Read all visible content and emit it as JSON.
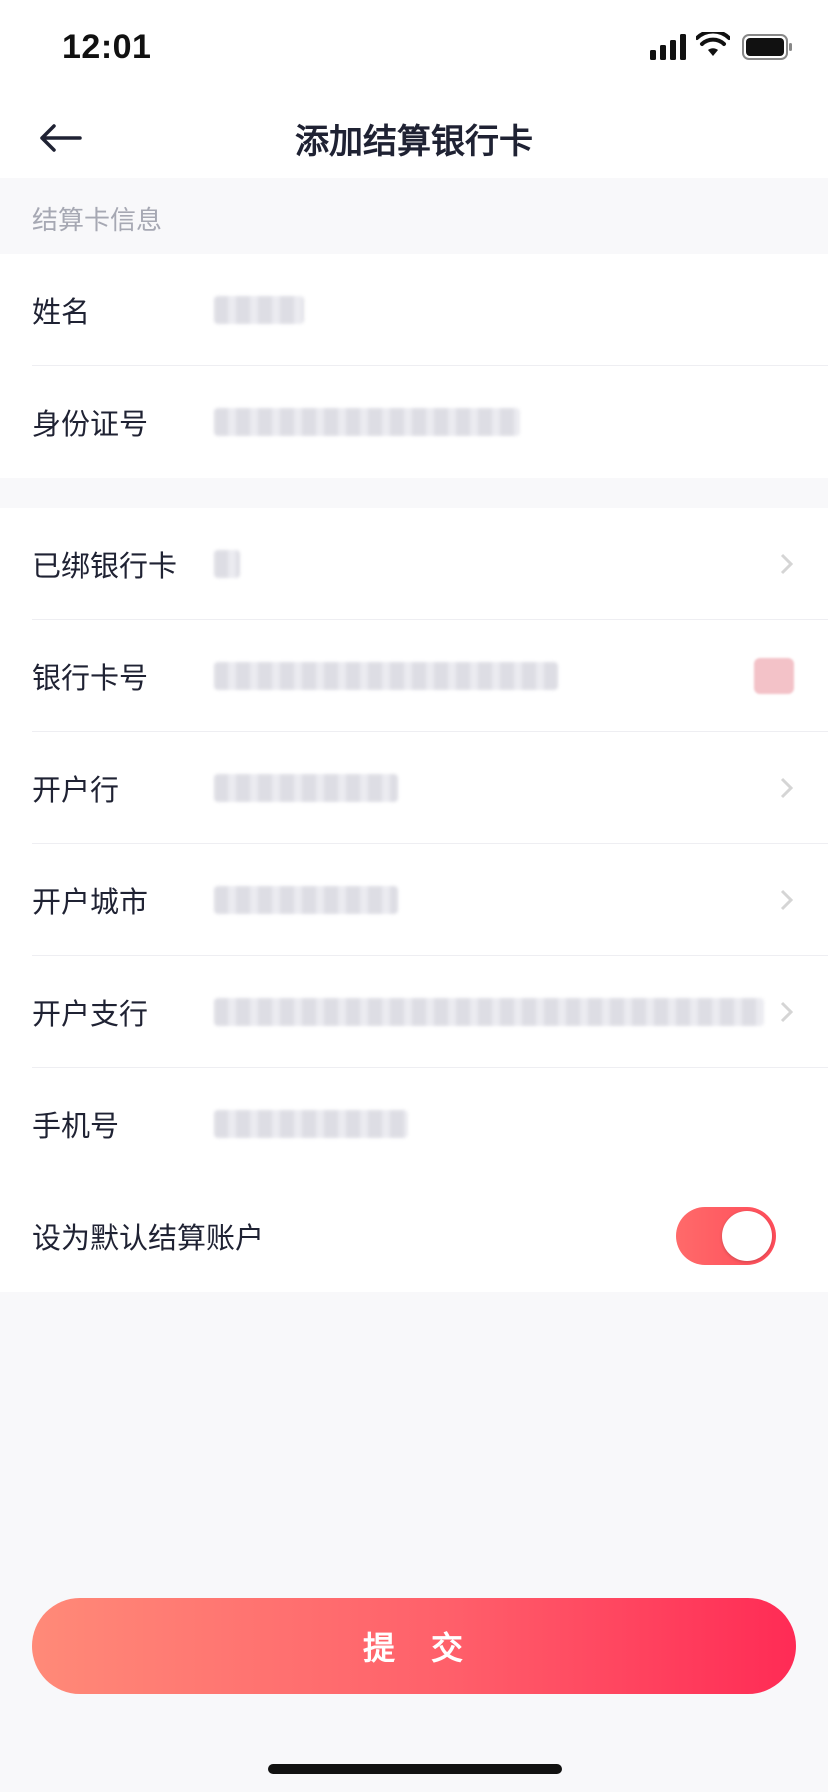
{
  "status_bar": {
    "time": "12:01",
    "icons": [
      "signal-icon",
      "wifi-icon",
      "battery-icon"
    ]
  },
  "nav": {
    "title": "添加结算银行卡",
    "back_icon": "back-arrow-icon"
  },
  "section": {
    "header": "结算卡信息"
  },
  "group1": [
    {
      "label": "姓名"
    },
    {
      "label": "身份证号"
    }
  ],
  "group2": [
    {
      "label": "已绑银行卡",
      "trailing": "chevron-right-icon"
    },
    {
      "label": "银行卡号",
      "trailing": "camera-icon"
    },
    {
      "label": "开户行",
      "trailing": "chevron-right-icon"
    },
    {
      "label": "开户城市",
      "trailing": "chevron-right-icon"
    },
    {
      "label": "开户支行",
      "trailing": "chevron-right-icon"
    },
    {
      "label": "手机号"
    }
  ],
  "default_account": {
    "label": "设为默认结算账户",
    "enabled": true
  },
  "submit": {
    "label": "提　交"
  },
  "colors": {
    "accent": "#ff4d5a",
    "background": "#f8f8fa",
    "text": "#1f2233",
    "muted": "#a6a8b3"
  }
}
